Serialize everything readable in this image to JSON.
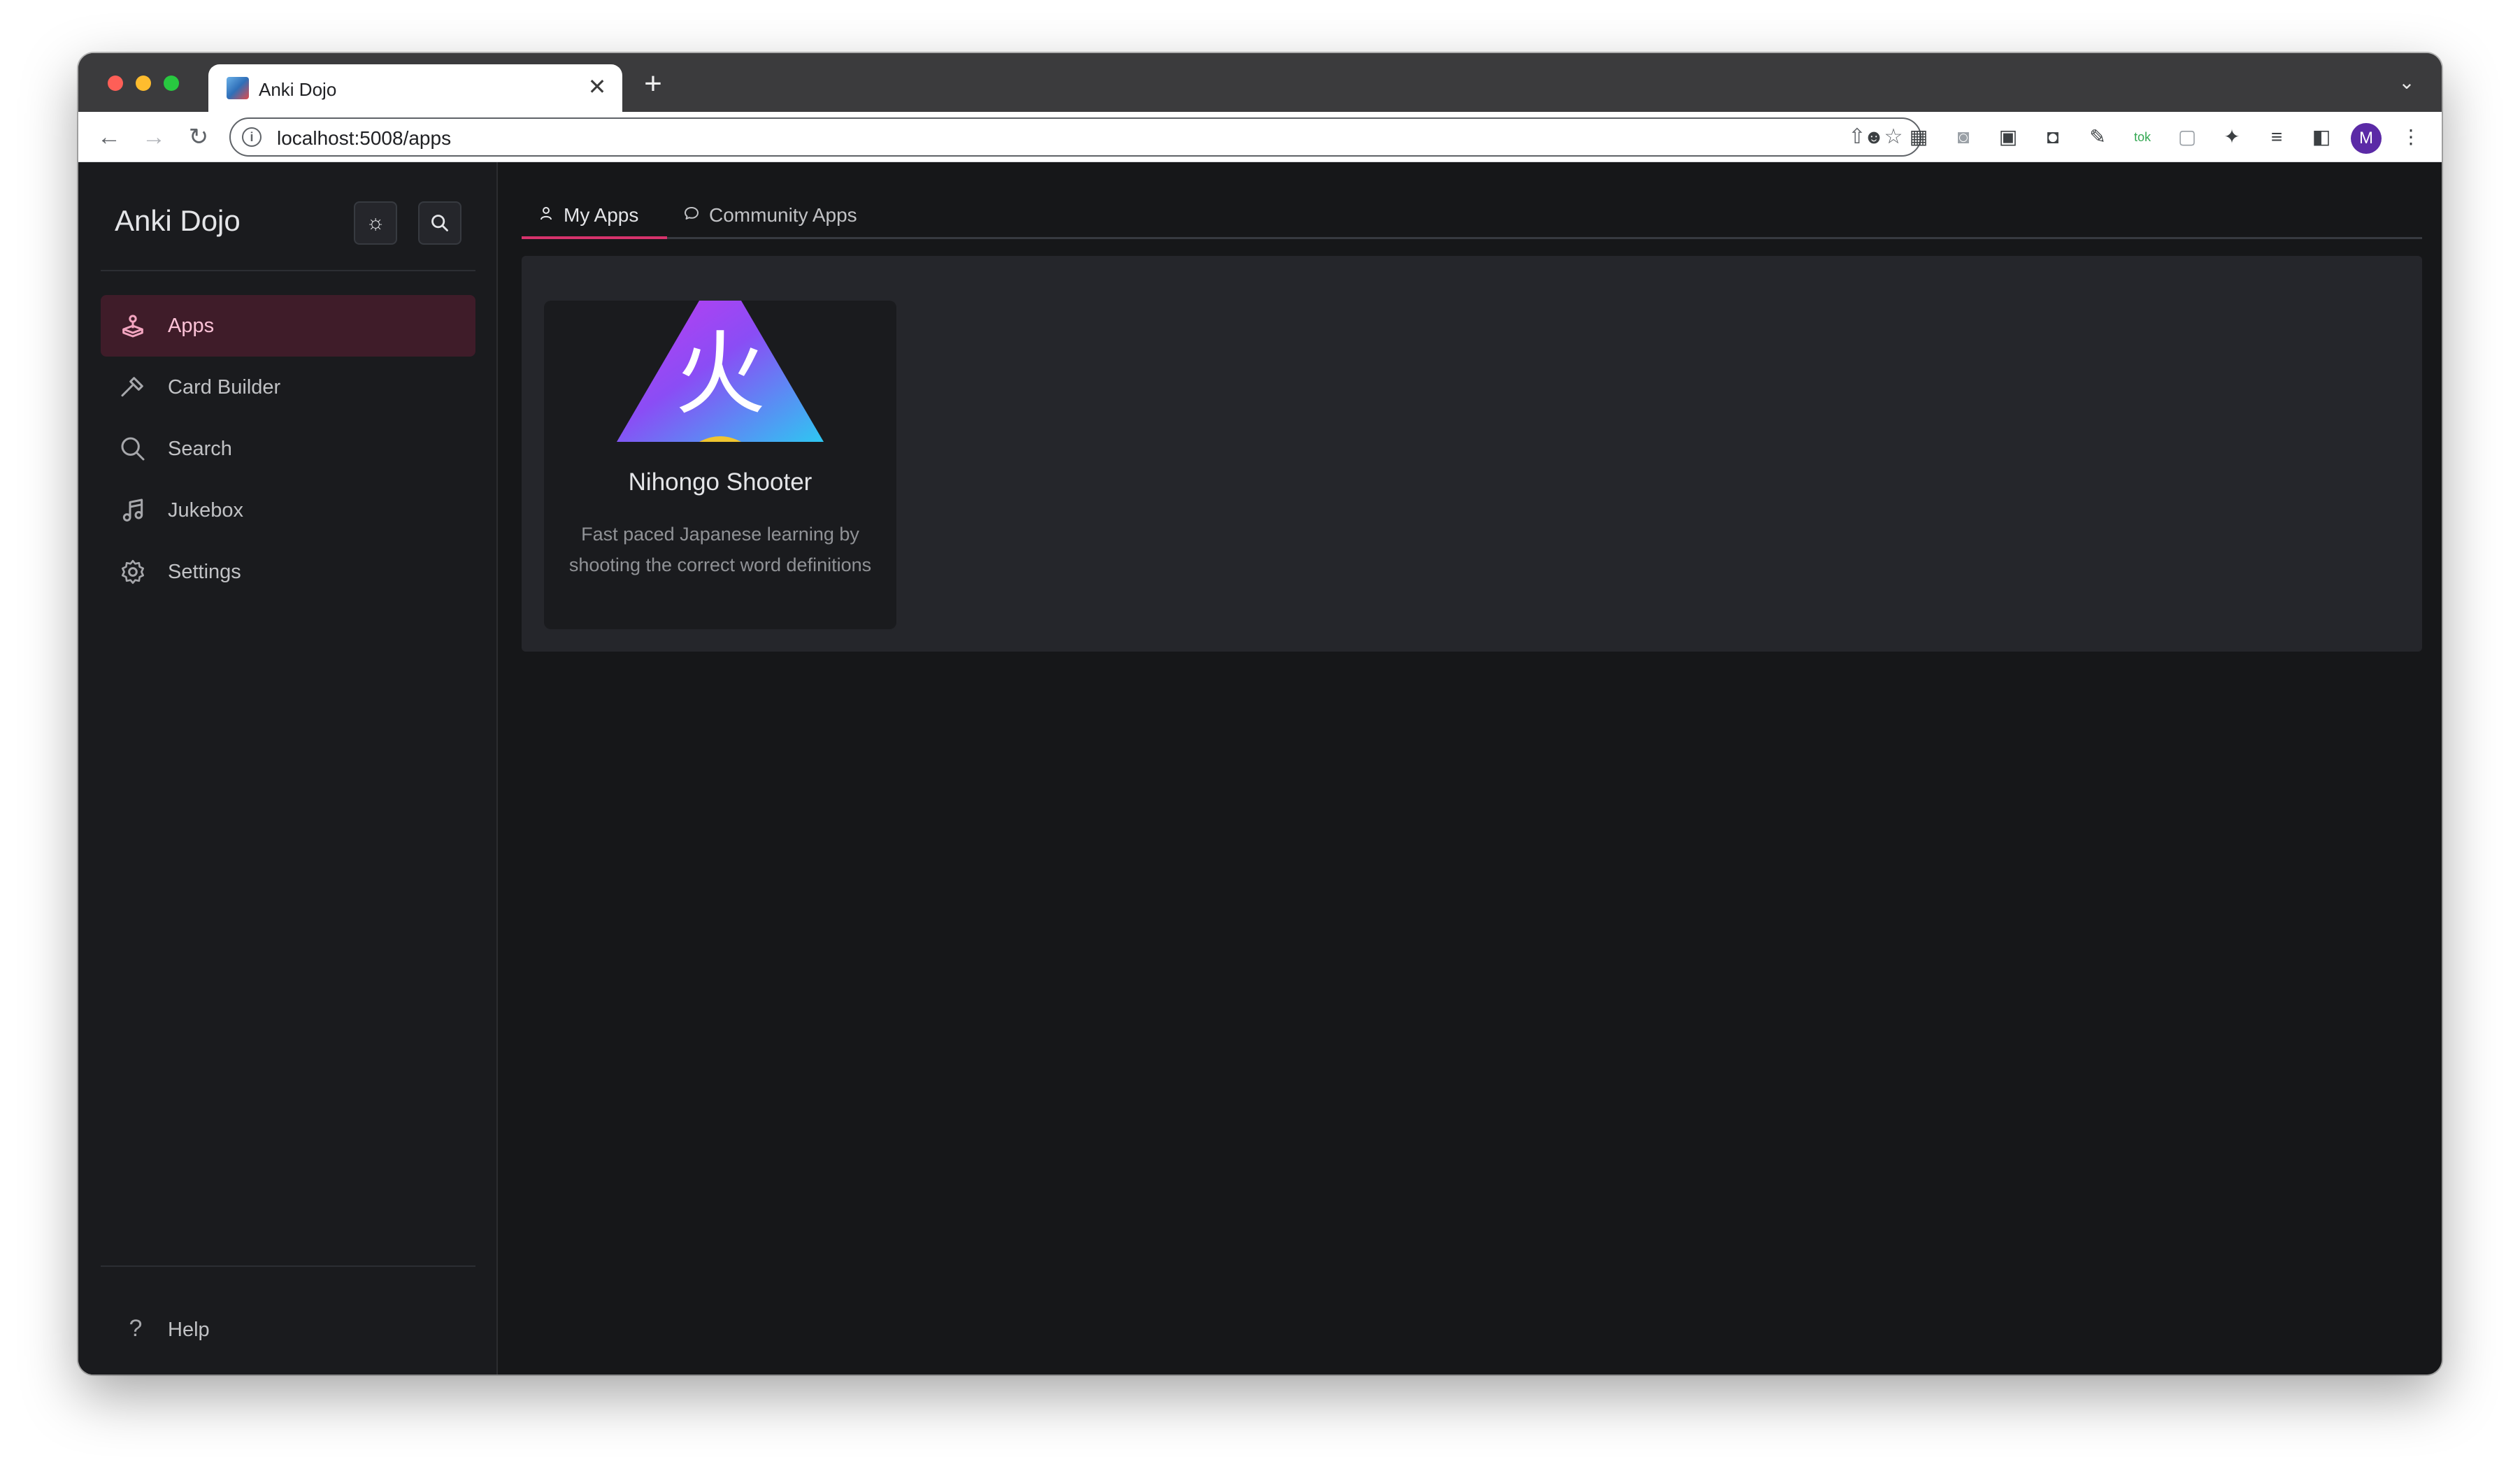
{
  "browser": {
    "tab_title": "Anki Dojo",
    "tab_close": "✕",
    "new_tab": "+",
    "url": "localhost:5008/apps",
    "avatar_letter": "M"
  },
  "sidebar": {
    "brand": "Anki Dojo",
    "items": [
      {
        "label": "Apps",
        "icon": "gamepad-icon",
        "active": true
      },
      {
        "label": "Card Builder",
        "icon": "hammer-icon",
        "active": false
      },
      {
        "label": "Search",
        "icon": "search-icon",
        "active": false
      },
      {
        "label": "Jukebox",
        "icon": "music-icon",
        "active": false
      },
      {
        "label": "Settings",
        "icon": "gear-icon",
        "active": false
      }
    ],
    "help_label": "Help"
  },
  "main": {
    "tabs": [
      {
        "label": "My Apps",
        "icon": "user-icon",
        "active": true
      },
      {
        "label": "Community Apps",
        "icon": "chat-icon",
        "active": false
      }
    ],
    "apps": [
      {
        "title": "Nihongo Shooter",
        "logo_char": "火",
        "description": "Fast paced Japanese learning by shooting the correct word definitions"
      }
    ]
  },
  "colors": {
    "accent": "#d6336c",
    "active_nav_bg": "#3f1c29",
    "background": "#161719",
    "panel": "#25262b"
  }
}
